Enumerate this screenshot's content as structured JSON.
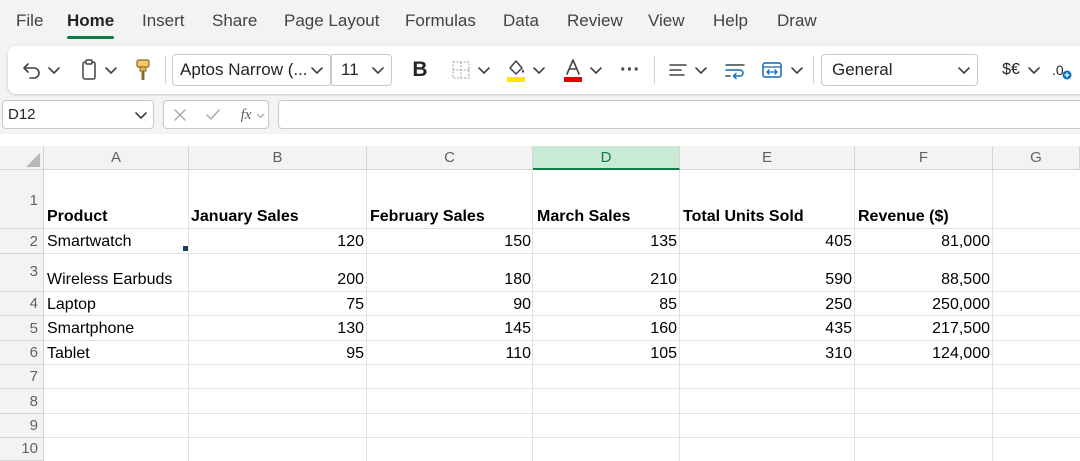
{
  "menu": {
    "tabs": [
      "File",
      "Home",
      "Insert",
      "Share",
      "Page Layout",
      "Formulas",
      "Data",
      "Review",
      "View",
      "Help",
      "Draw"
    ],
    "active": "Home"
  },
  "ribbon": {
    "font_name": "Aptos Narrow (...",
    "font_size": "11",
    "bold_label": "B",
    "number_format": "General",
    "currency_label": "$€",
    "decimal_label": ".0",
    "more_label": "···",
    "icons": [
      "undo-icon",
      "clipboard-icon",
      "format-painter-icon",
      "bold-icon",
      "borders-icon",
      "fill-color-icon",
      "font-color-icon",
      "more-icon",
      "align-icon",
      "wrap-text-icon",
      "merge-icon",
      "currency-icon",
      "increase-decimal-icon"
    ],
    "colors": {
      "fill_swatch": "#ffe500",
      "font_swatch": "#e00000",
      "accent": "#107c41"
    }
  },
  "formula_bar": {
    "name_box": "D12",
    "fx_label": "fx",
    "formula": ""
  },
  "sheet": {
    "selected_column": "D",
    "columns": [
      "A",
      "B",
      "C",
      "D",
      "E",
      "F",
      "G"
    ],
    "rows": [
      "1",
      "2",
      "3",
      "4",
      "5",
      "6",
      "7",
      "8",
      "9",
      "10"
    ],
    "headers": [
      "Product",
      "January Sales",
      "February Sales",
      "March Sales",
      "Total Units Sold",
      "Revenue ($)"
    ],
    "data": [
      [
        "Smartwatch",
        "120",
        "150",
        "135",
        "405",
        "81,000"
      ],
      [
        "Wireless Earbuds",
        "200",
        "180",
        "210",
        "590",
        "88,500"
      ],
      [
        "Laptop",
        "75",
        "90",
        "85",
        "250",
        "250,000"
      ],
      [
        "Smartphone",
        "130",
        "145",
        "160",
        "435",
        "217,500"
      ],
      [
        "Tablet",
        "95",
        "110",
        "105",
        "310",
        "124,000"
      ]
    ]
  }
}
